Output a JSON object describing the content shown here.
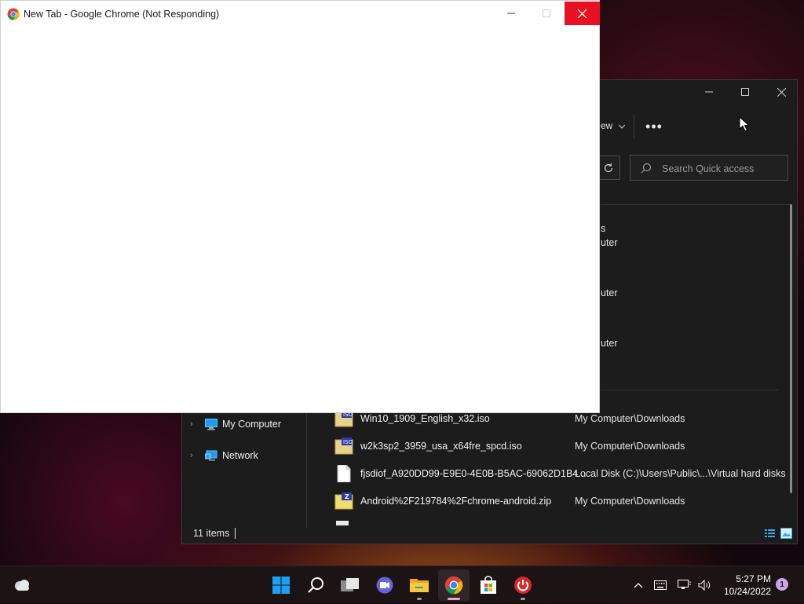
{
  "chrome": {
    "title": "New Tab - Google Chrome (Not Responding)"
  },
  "explorer": {
    "toolbar_partial": "ew",
    "more_label": "•••",
    "search": {
      "placeholder": "Search Quick access"
    },
    "partial_item_texts": [
      "s",
      "uter",
      "uter",
      "uter"
    ],
    "nav": [
      {
        "label": "My Computer"
      },
      {
        "label": "Network"
      }
    ],
    "files": [
      {
        "name": "Win10_1909_English_x32.iso",
        "location": "My Computer\\Downloads",
        "icon": "iso-file-icon"
      },
      {
        "name": "w2k3sp2_3959_usa_x64fre_spcd.iso",
        "location": "My Computer\\Downloads",
        "icon": "iso-file-icon"
      },
      {
        "name": "fjsdiof_A920DD99-E9E0-4E0B-B5AC-69062D1B4...",
        "location": "Local Disk (C:)\\Users\\Public\\...\\Virtual hard disks",
        "icon": "blank-file-icon"
      },
      {
        "name": "Android%2F219784%2Fchrome-android.zip",
        "location": "My Computer\\Downloads",
        "icon": "zip-file-icon"
      }
    ],
    "status": {
      "count": "11 items"
    }
  },
  "taskbar": {
    "apps": [
      "start-icon",
      "search-icon",
      "task-view-icon",
      "chat-icon",
      "file-explorer-icon",
      "chrome-icon",
      "store-icon",
      "power-app-icon"
    ],
    "clock": {
      "time": "5:27 PM",
      "date": "10/24/2022"
    },
    "notification_count": "1"
  },
  "colors": {
    "close_red": "#e81123",
    "explorer_bg": "#1c1c1c",
    "taskbar_bg": "#1b1314",
    "accent_blue": "#1e9bf0"
  }
}
